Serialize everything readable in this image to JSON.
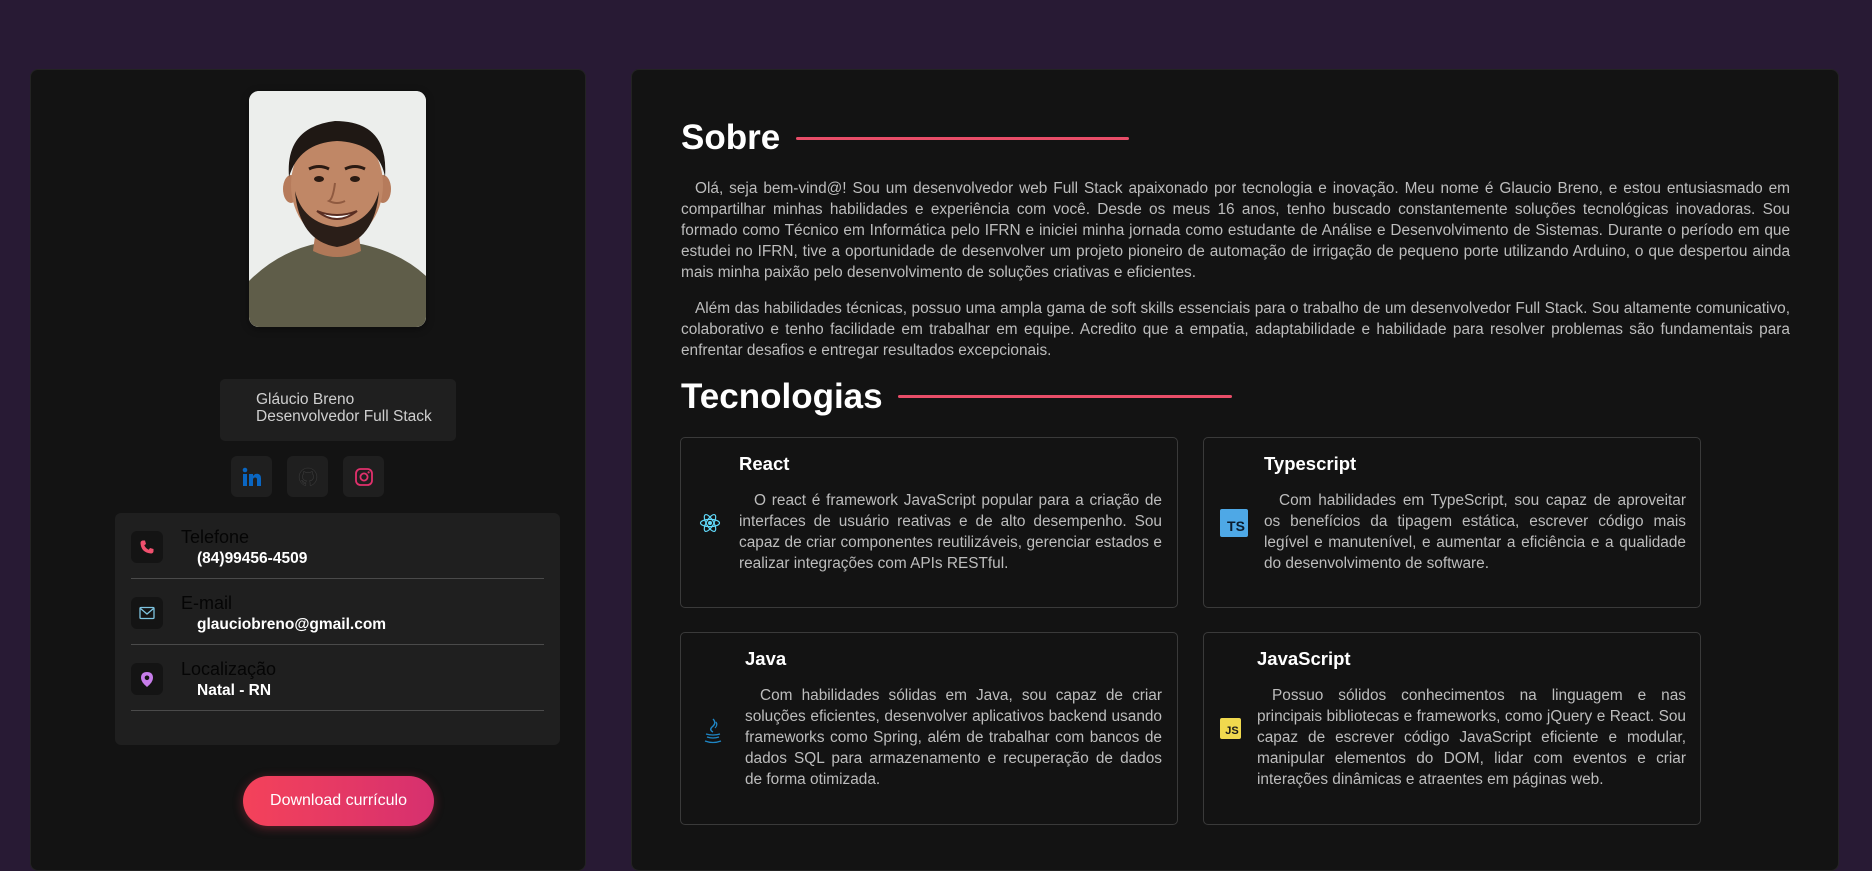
{
  "profile": {
    "name": "Gláucio Breno",
    "role": "Desenvolvedor Full Stack"
  },
  "social": {
    "linkedin_icon": "linkedin-icon",
    "github_icon": "github-icon",
    "instagram_icon": "instagram-icon"
  },
  "contacts": [
    {
      "label": "Telefone",
      "value": "(84)99456-4509",
      "icon": "phone-icon",
      "color": "#f0506e"
    },
    {
      "label": "E-mail",
      "value": "glauciobreno@gmail.com",
      "icon": "mail-icon",
      "color": "#7ec4e0"
    },
    {
      "label": "Localização",
      "value": "Natal - RN",
      "icon": "location-pin-icon",
      "color": "#c77dea"
    }
  ],
  "download_label": "Download currículo",
  "about": {
    "title": "Sobre",
    "paragraphs": [
      "Olá, seja bem-vind@! Sou um desenvolvedor web Full Stack apaixonado por tecnologia e inovação. Meu nome é Glaucio Breno, e estou entusiasmado em compartilhar minhas habilidades e experiência com você. Desde os meus 16 anos, tenho buscado constantemente soluções tecnológicas inovadoras. Sou formado como Técnico em Informática pelo IFRN e iniciei minha jornada como estudante de Análise e Desenvolvimento de Sistemas. Durante o período em que estudei no IFRN, tive a oportunidade de desenvolver um projeto pioneiro de automação de irrigação de pequeno porte utilizando Arduino, o que despertou ainda mais minha paixão pelo desenvolvimento de soluções criativas e eficientes.",
      "Além das habilidades técnicas, possuo uma ampla gama de soft skills essenciais para o trabalho de um desenvolvedor Full Stack. Sou altamente comunicativo, colaborativo e tenho facilidade em trabalhar em equipe. Acredito que a empatia, adaptabilidade e habilidade para resolver problemas são fundamentais para enfrentar desafios e entregar resultados excepcionais."
    ]
  },
  "technologies": {
    "title": "Tecnologias",
    "items": [
      {
        "name": "React",
        "icon": "react-icon",
        "description": "O react é framework JavaScript popular para a criação de interfaces de usuário reativas e de alto desempenho. Sou capaz de criar componentes reutilizáveis, gerenciar estados e realizar integrações com APIs RESTful."
      },
      {
        "name": "Typescript",
        "icon": "typescript-icon",
        "icon_text": "TS",
        "description": "Com habilidades em TypeScript, sou capaz de aproveitar os benefícios da tipagem estática, escrever código mais legível e manutenível, e aumentar a eficiência e a qualidade do desenvolvimento de software."
      },
      {
        "name": "Java",
        "icon": "java-icon",
        "description": "Com habilidades sólidas em Java, sou capaz de criar soluções eficientes, desenvolver aplicativos backend usando frameworks como Spring, além de trabalhar com bancos de dados SQL para armazenamento e recuperação de dados de forma otimizada."
      },
      {
        "name": "JavaScript",
        "icon": "javascript-icon",
        "icon_text": "JS",
        "description": "Possuo sólidos conhecimentos na linguagem e nas principais bibliotecas e frameworks, como jQuery e React. Sou capaz de escrever código JavaScript eficiente e modular, manipular elementos do DOM, lidar com eventos e criar interações dinâmicas e atraentes em páginas web."
      }
    ]
  },
  "colors": {
    "background": "#281a34",
    "card": "#131313",
    "accent": "#e84d68",
    "linkedin": "#0a66c2",
    "instagram": "#e1306c"
  }
}
